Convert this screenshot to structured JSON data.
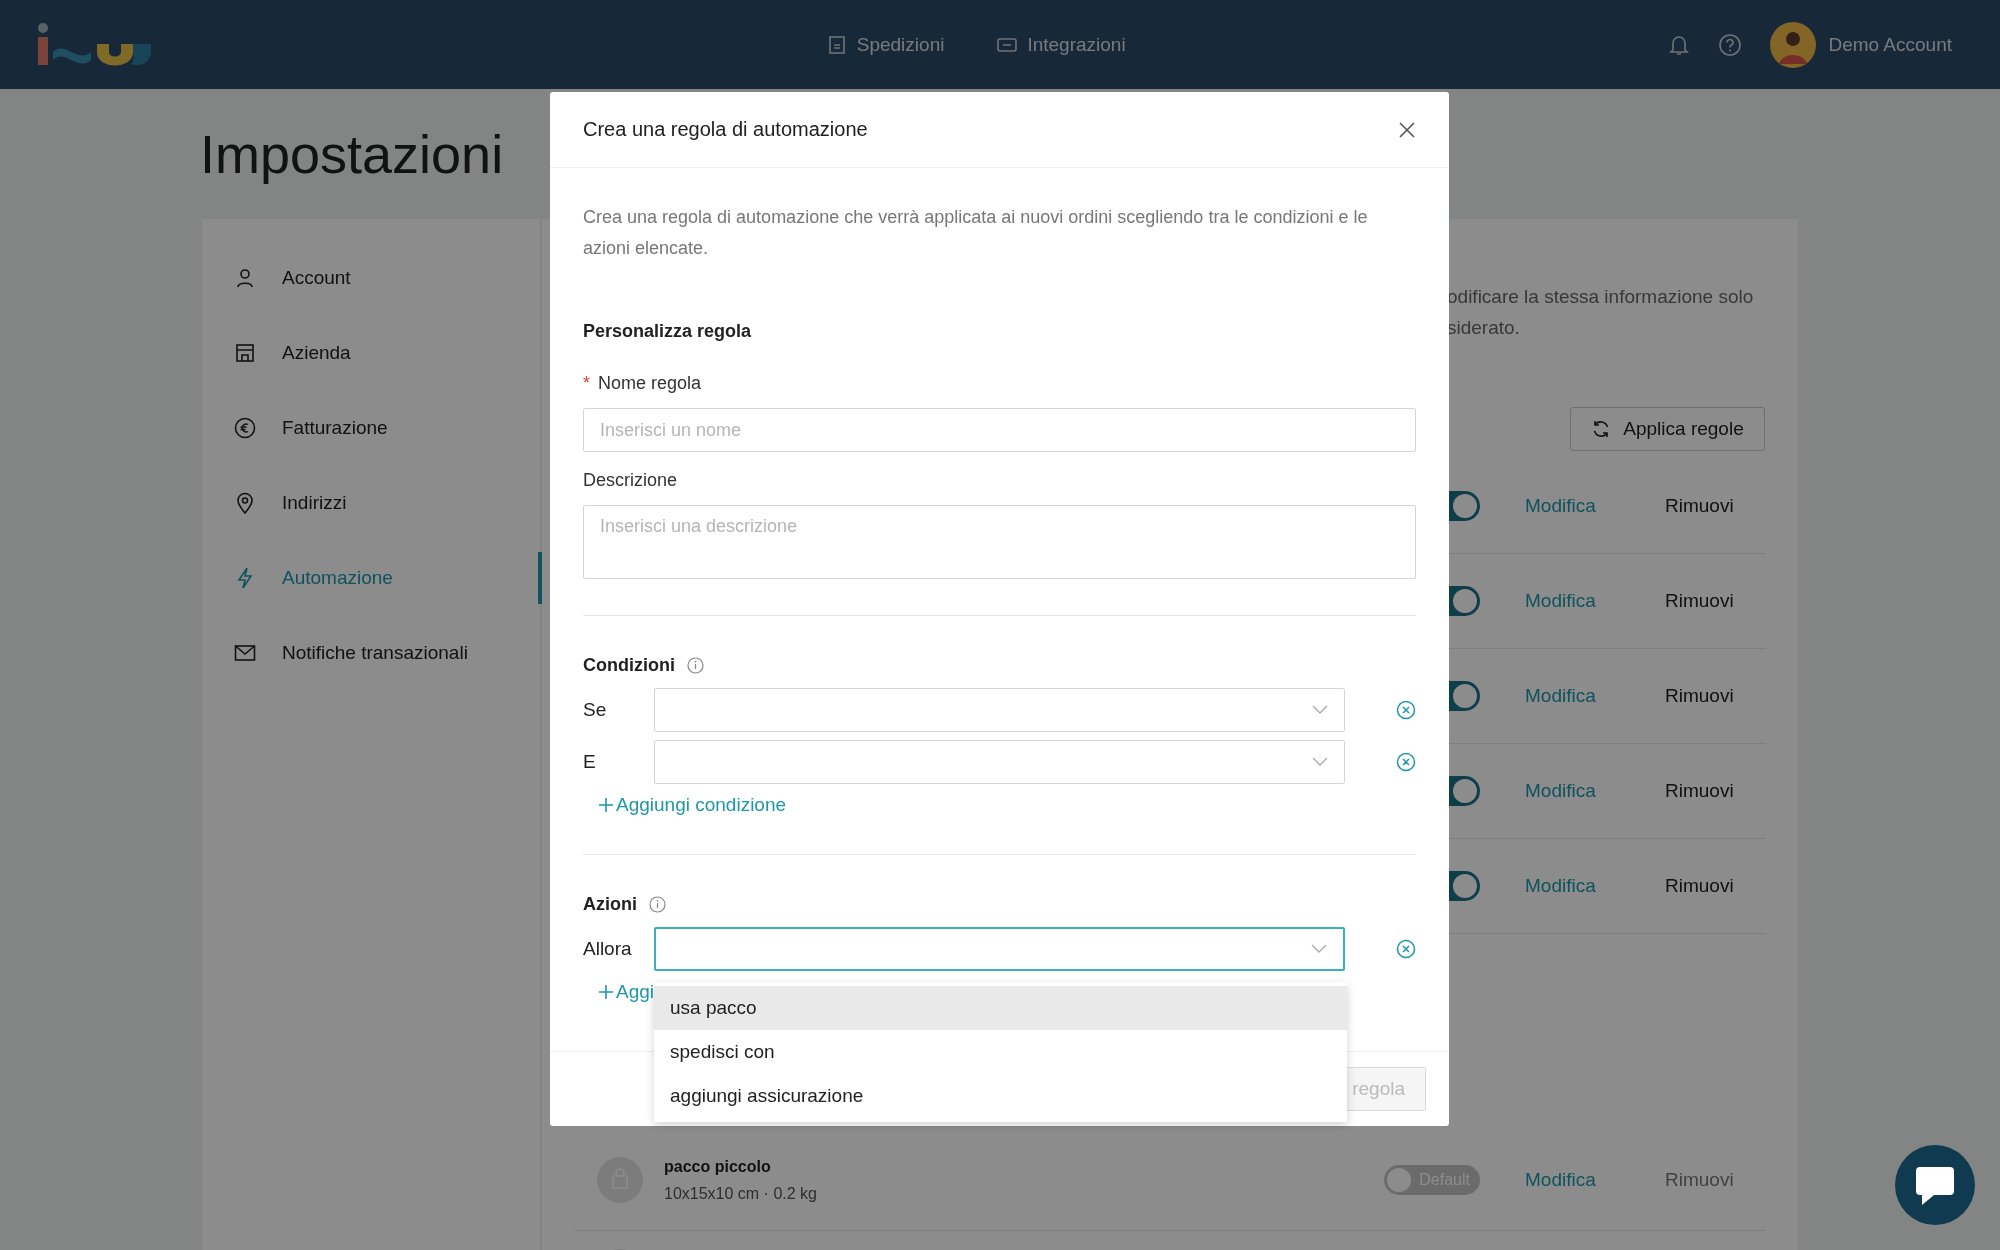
{
  "topbar": {
    "nav": [
      {
        "label": "Spedizioni"
      },
      {
        "label": "Integrazioni"
      }
    ],
    "user": {
      "name": "Demo Account"
    }
  },
  "page_title": "Impostazioni",
  "sidebar": {
    "items": [
      {
        "label": "Account",
        "selected": false
      },
      {
        "label": "Azienda",
        "selected": false
      },
      {
        "label": "Fatturazione",
        "selected": false
      },
      {
        "label": "Indirizzi",
        "selected": false
      },
      {
        "label": "Automazione",
        "selected": true
      },
      {
        "label": "Notifiche transazionali",
        "selected": false
      }
    ]
  },
  "content": {
    "intro_lines": [
      "odificare la stessa informazione solo",
      "siderato."
    ],
    "apply_button": "Applica regole",
    "rules": [
      {
        "on": true,
        "edit": "Modifica",
        "remove": "Rimuovi"
      },
      {
        "on": true,
        "edit": "Modifica",
        "remove": "Rimuovi"
      },
      {
        "on": true,
        "edit": "Modifica",
        "remove": "Rimuovi"
      },
      {
        "on": true,
        "edit": "Modifica",
        "remove": "Rimuovi"
      },
      {
        "on": true,
        "edit": "Modifica",
        "remove": "Rimuovi"
      }
    ],
    "packages": [
      {
        "name": "pacco piccolo",
        "details": "10x15x10 cm · 0.2 kg",
        "on": false,
        "toggle_label": "Default",
        "edit": "Modifica",
        "remove": "Rimuovi",
        "remove_disabled": true
      }
    ]
  },
  "modal": {
    "title": "Crea una regola di automazione",
    "description": "Crea una regola di automazione che verrà applicata ai nuovi ordini scegliendo tra le condizioni e le azioni elencate.",
    "section_title": "Personalizza regola",
    "name_field": {
      "required_mark": "*",
      "label": "Nome regola",
      "placeholder": "Inserisci un nome"
    },
    "description_field": {
      "label": "Descrizione",
      "placeholder": "Inserisci una descrizione"
    },
    "conditions": {
      "title": "Condizioni",
      "rows": [
        {
          "label": "Se",
          "focused": false
        },
        {
          "label": "E",
          "focused": false
        }
      ],
      "add_label": "Aggiungi condizione"
    },
    "actions": {
      "title": "Azioni",
      "rows": [
        {
          "label": "Allora",
          "focused": true
        }
      ],
      "add_label": "Aggi"
    },
    "footer_button": "regola",
    "dropdown": {
      "options": [
        {
          "label": "usa pacco",
          "hovered": true
        },
        {
          "label": "spedisci con",
          "hovered": false
        },
        {
          "label": "aggiungi assicurazione",
          "hovered": false
        }
      ]
    }
  }
}
